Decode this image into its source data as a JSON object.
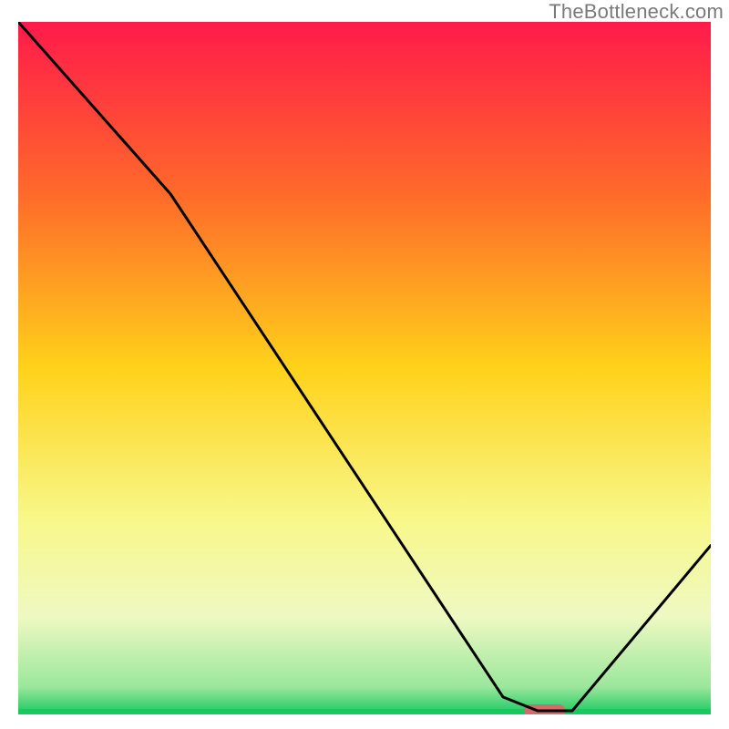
{
  "watermark": "TheBottleneck.com",
  "chart_data": {
    "type": "line",
    "title": "",
    "xlabel": "",
    "ylabel": "",
    "xlim": [
      0,
      100
    ],
    "ylim": [
      0,
      100
    ],
    "gradient_stops": [
      {
        "offset": 0,
        "color": "#ff1a4b"
      },
      {
        "offset": 25,
        "color": "#ff6a2a"
      },
      {
        "offset": 50,
        "color": "#ffd21a"
      },
      {
        "offset": 72,
        "color": "#f8f88a"
      },
      {
        "offset": 86,
        "color": "#eef9c2"
      },
      {
        "offset": 96,
        "color": "#9be79c"
      },
      {
        "offset": 100,
        "color": "#18c960"
      }
    ],
    "series": [
      {
        "name": "bottleneck-curve",
        "x": [
          0,
          22,
          70,
          75,
          80,
          100
        ],
        "y": [
          100,
          75,
          2,
          0,
          0,
          24
        ]
      }
    ],
    "marker": {
      "name": "optimum-marker",
      "x_center": 76,
      "y": 0,
      "width_pct": 6,
      "color": "#d56a6e"
    },
    "baseline_color": "#17c95f",
    "curve_stroke": "#000000",
    "curve_stroke_width": 3
  }
}
